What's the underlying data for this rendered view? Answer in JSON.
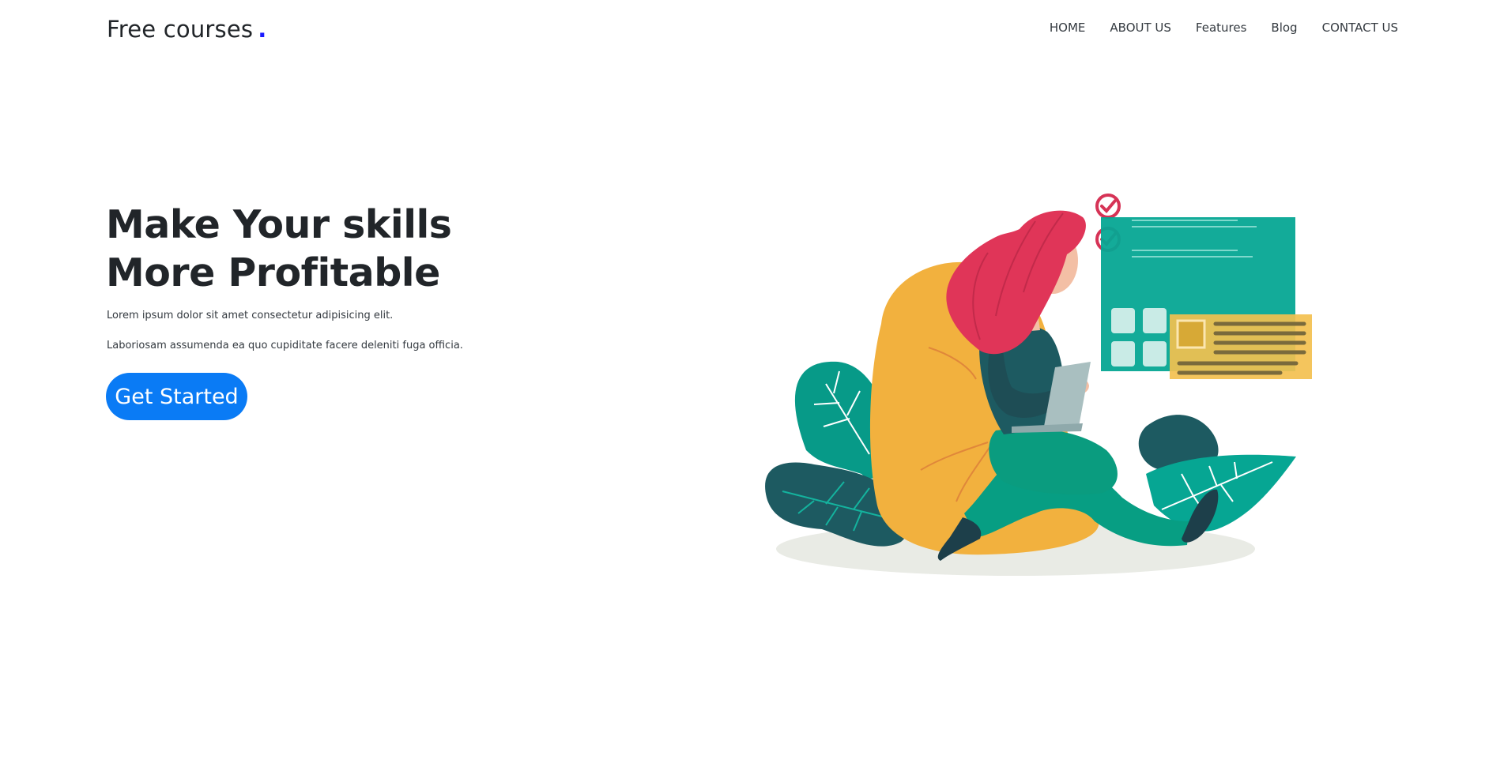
{
  "brand": {
    "name": "Free courses",
    "dot": "."
  },
  "nav": {
    "items": [
      {
        "label": "HOME"
      },
      {
        "label": "ABOUT US"
      },
      {
        "label": "Features"
      },
      {
        "label": "Blog"
      },
      {
        "label": "CONTACT US"
      }
    ]
  },
  "hero": {
    "title_line1": "Make Your skills",
    "title_line2": "More Profitable",
    "text1": "Lorem ipsum dolor sit amet consectetur adipisicing elit.",
    "text2": "Laboriosam assumenda ea quo cupiditate facere deleniti fuga officia.",
    "cta_label": "Get Started"
  },
  "colors": {
    "accent": "#0a7bf5",
    "brand_dot": "#1a1aff",
    "teal": "#06a693",
    "dark_teal": "#1d5a61",
    "hair": "#e03558",
    "beanbag": "#f2b13e",
    "card_yellow": "#f3c04f"
  },
  "illustration": {
    "icon": "woman-with-laptop-illustration"
  }
}
